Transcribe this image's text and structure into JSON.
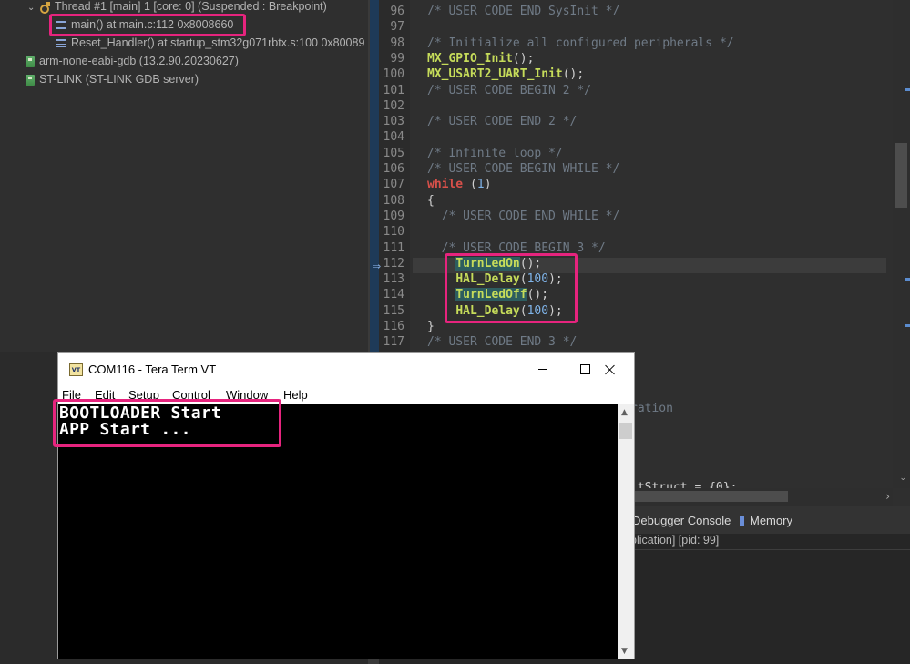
{
  "debug_tree": {
    "thread": "Thread #1 [main] 1 [core: 0] (Suspended : Breakpoint)",
    "frames": [
      "main() at main.c:112 0x8008660",
      "Reset_Handler() at startup_stm32g071rbtx.s:100 0x80089"
    ],
    "processes": [
      "arm-none-eabi-gdb (13.2.90.20230627)",
      "ST-LINK (ST-LINK GDB server)"
    ],
    "icons": {
      "frame": "stack-frame-icon",
      "process": "gdb-process-icon",
      "thread": "suspended-thread-icon"
    }
  },
  "editor": {
    "lines": [
      {
        "n": "96",
        "parts": [
          [
            "cmt",
            "/* USER CODE END SysInit */"
          ]
        ]
      },
      {
        "n": "97",
        "parts": []
      },
      {
        "n": "98",
        "parts": [
          [
            "cmt",
            "/* Initialize all configured peripherals */"
          ]
        ]
      },
      {
        "n": "99",
        "parts": [
          [
            "fn",
            "MX_GPIO_Init"
          ],
          [
            "punc",
            "();"
          ]
        ]
      },
      {
        "n": "100",
        "parts": [
          [
            "fn",
            "MX_USART2_UART_Init"
          ],
          [
            "punc",
            "();"
          ]
        ]
      },
      {
        "n": "101",
        "parts": [
          [
            "cmt",
            "/* USER CODE BEGIN 2 */"
          ]
        ]
      },
      {
        "n": "102",
        "parts": []
      },
      {
        "n": "103",
        "parts": [
          [
            "cmt",
            "/* USER CODE END 2 */"
          ]
        ]
      },
      {
        "n": "104",
        "parts": []
      },
      {
        "n": "105",
        "parts": [
          [
            "cmt",
            "/* Infinite loop */"
          ]
        ]
      },
      {
        "n": "106",
        "parts": [
          [
            "cmt",
            "/* USER CODE BEGIN WHILE */"
          ]
        ]
      },
      {
        "n": "107",
        "parts": [
          [
            "kw",
            "while"
          ],
          [
            "punc",
            " ("
          ],
          [
            "num",
            "1"
          ],
          [
            "punc",
            ")"
          ]
        ]
      },
      {
        "n": "108",
        "parts": [
          [
            "punc",
            "{"
          ]
        ]
      },
      {
        "n": "109",
        "parts": [
          [
            "cmt",
            "  /* USER CODE END WHILE */"
          ]
        ]
      },
      {
        "n": "110",
        "parts": []
      },
      {
        "n": "111",
        "parts": [
          [
            "cmt",
            "  /* USER CODE BEGIN 3 */"
          ]
        ]
      },
      {
        "n": "112",
        "parts": [
          [
            "punc",
            "    "
          ],
          [
            "fn hl-bg",
            "TurnLedOn"
          ],
          [
            "punc",
            "();"
          ]
        ]
      },
      {
        "n": "113",
        "parts": [
          [
            "punc",
            "    "
          ],
          [
            "fn",
            "HAL_Delay"
          ],
          [
            "punc",
            "("
          ],
          [
            "num",
            "100"
          ],
          [
            "punc",
            ");"
          ]
        ]
      },
      {
        "n": "114",
        "parts": [
          [
            "punc",
            "    "
          ],
          [
            "fn hl-bg",
            "TurnLedOff"
          ],
          [
            "punc",
            "();"
          ]
        ]
      },
      {
        "n": "115",
        "parts": [
          [
            "punc",
            "    "
          ],
          [
            "fn",
            "HAL_Delay"
          ],
          [
            "punc",
            "("
          ],
          [
            "num",
            "100"
          ],
          [
            "punc",
            ");"
          ]
        ]
      },
      {
        "n": "116",
        "parts": [
          [
            "punc",
            "}"
          ]
        ]
      },
      {
        "n": "117",
        "parts": [
          [
            "cmt",
            "/* USER CODE END 3 */"
          ]
        ]
      }
    ],
    "partial_visible": [
      {
        "text": "ration",
        "cls": "cmt"
      },
      {
        "text": "itStruct = {0};",
        "cls": "punc"
      }
    ]
  },
  "bottom_panel": {
    "tabs": [
      "Debugger Console",
      "Memory"
    ],
    "status": "plication] [pid: 99]"
  },
  "teraterm": {
    "icon_label": "VT",
    "title": "COM116 - Tera Term VT",
    "menu": [
      "File",
      "Edit",
      "Setup",
      "Control",
      "Window",
      "Help"
    ],
    "screen_lines": [
      "BOOTLOADER Start",
      "APP Start ..."
    ]
  },
  "colors": {
    "callout": "#e6247e",
    "function": "#c6dc5a",
    "keyword": "#d8504a",
    "comment": "#6f7a86",
    "number": "#7fb3e8"
  }
}
